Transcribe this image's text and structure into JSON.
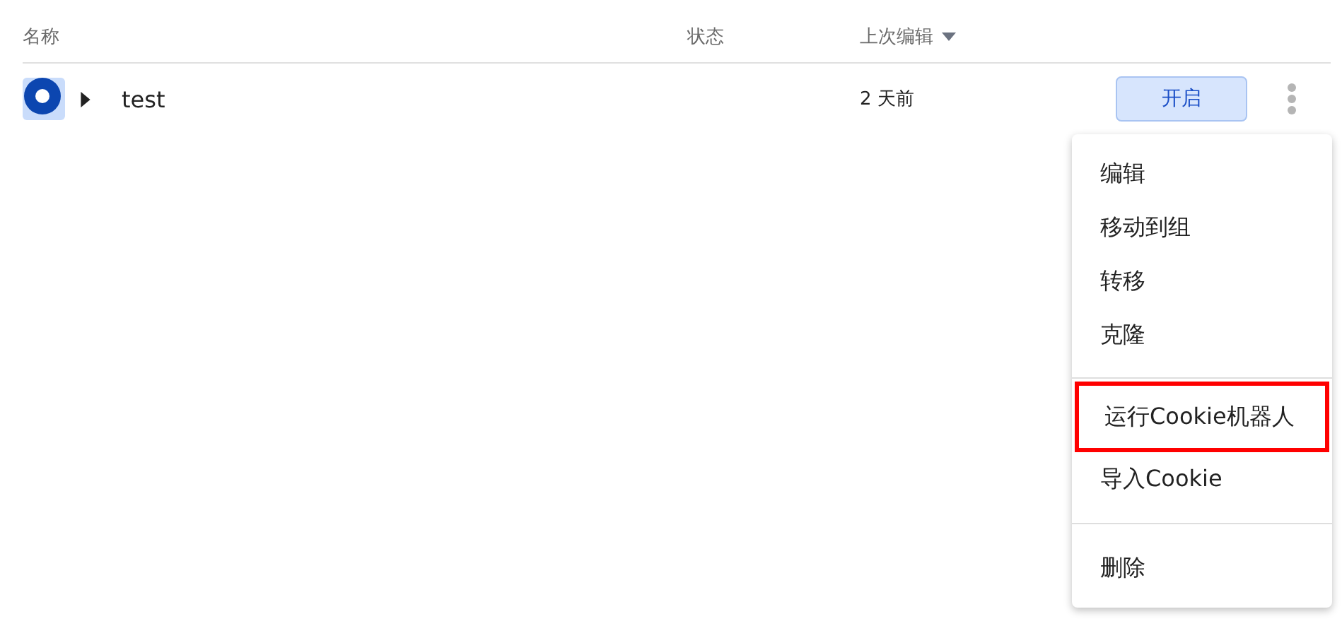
{
  "table": {
    "columns": [
      {
        "label": "名称",
        "sorted": false
      },
      {
        "label": "状态",
        "sorted": false
      },
      {
        "label": "上次编辑",
        "sorted": true
      }
    ],
    "rows": [
      {
        "name": "test",
        "expanded": false,
        "status": "",
        "edited": "2 天前",
        "action": "开启"
      }
    ]
  },
  "menu": {
    "sections": [
      {
        "items": [
          {
            "label": "编辑",
            "highlighted": false
          },
          {
            "label": "移动到组",
            "highlighted": false
          },
          {
            "label": "转移",
            "highlighted": false
          },
          {
            "label": "克隆",
            "highlighted": false
          }
        ]
      },
      {
        "items": [
          {
            "label": "运行Cookie机器人",
            "highlighted": true
          },
          {
            "label": "导入Cookie",
            "highlighted": false
          }
        ]
      },
      {
        "items": [
          {
            "label": "删除",
            "highlighted": false
          }
        ]
      }
    ]
  }
}
